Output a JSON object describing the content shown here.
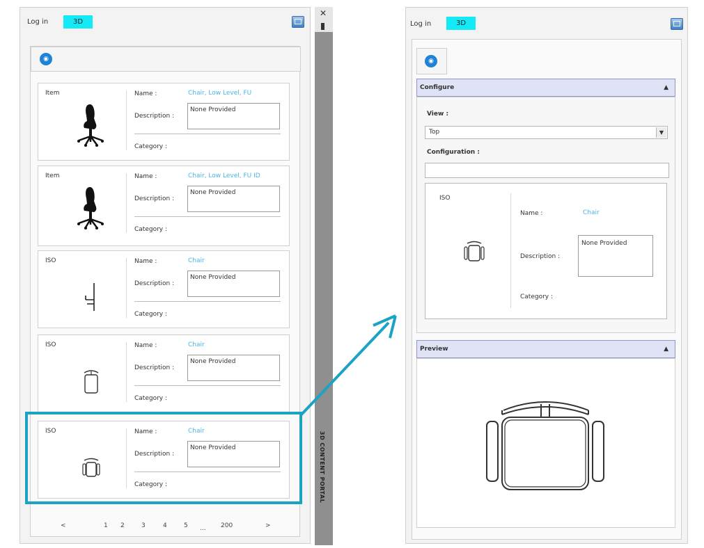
{
  "left": {
    "login_label": "Log in",
    "tab_3d": "3D",
    "cards": [
      {
        "type": "Item",
        "name_label": "Name :",
        "name_value": "Chair, Low Level, FU",
        "desc_label": "Description :",
        "desc_value": "None Provided",
        "cat_label": "Category :",
        "icon": "task-chair-silhouette-icon"
      },
      {
        "type": "Item",
        "name_label": "Name :",
        "name_value": "Chair, Low Level, FU ID",
        "desc_label": "Description :",
        "desc_value": "None Provided",
        "cat_label": "Category :",
        "icon": "task-chair-silhouette-icon"
      },
      {
        "type": "ISO",
        "name_label": "Name :",
        "name_value": "Chair",
        "desc_label": "Description :",
        "desc_value": "None Provided",
        "cat_label": "Category :",
        "icon": "chair-side-view-icon"
      },
      {
        "type": "ISO",
        "name_label": "Name :",
        "name_value": "Chair",
        "desc_label": "Description :",
        "desc_value": "None Provided",
        "cat_label": "Category :",
        "icon": "chair-front-view-icon"
      },
      {
        "type": "ISO",
        "name_label": "Name :",
        "name_value": "Chair",
        "desc_label": "Description :",
        "desc_value": "None Provided",
        "cat_label": "Category :",
        "icon": "chair-top-view-icon"
      }
    ],
    "pagination": {
      "prev": "<",
      "pages": [
        "1",
        "2",
        "3",
        "4",
        "5"
      ],
      "ellipsis": "...",
      "last": "200",
      "next": ">"
    },
    "side_strip_label": "3D CONTENT PORTAL"
  },
  "right": {
    "login_label": "Log in",
    "tab_3d": "3D",
    "configure": {
      "title": "Configure",
      "caret": "▲",
      "view_label": "View :",
      "view_value": "Top",
      "select_caret": "▼",
      "configuration_label": "Configuration :",
      "configuration_value": "",
      "card": {
        "type": "ISO",
        "name_label": "Name :",
        "name_value": "Chair",
        "desc_label": "Description :",
        "desc_value": "None Provided",
        "cat_label": "Category :",
        "icon": "chair-top-view-icon"
      }
    },
    "preview": {
      "title": "Preview",
      "caret": "▲",
      "icon": "chair-top-view-large-icon"
    }
  },
  "colors": {
    "accent_tab": "#14eaf6",
    "link": "#47b6ea",
    "highlight": "#1aa3c2",
    "section_header": "#dfe3f5",
    "circle_button": "#1e82d6"
  }
}
